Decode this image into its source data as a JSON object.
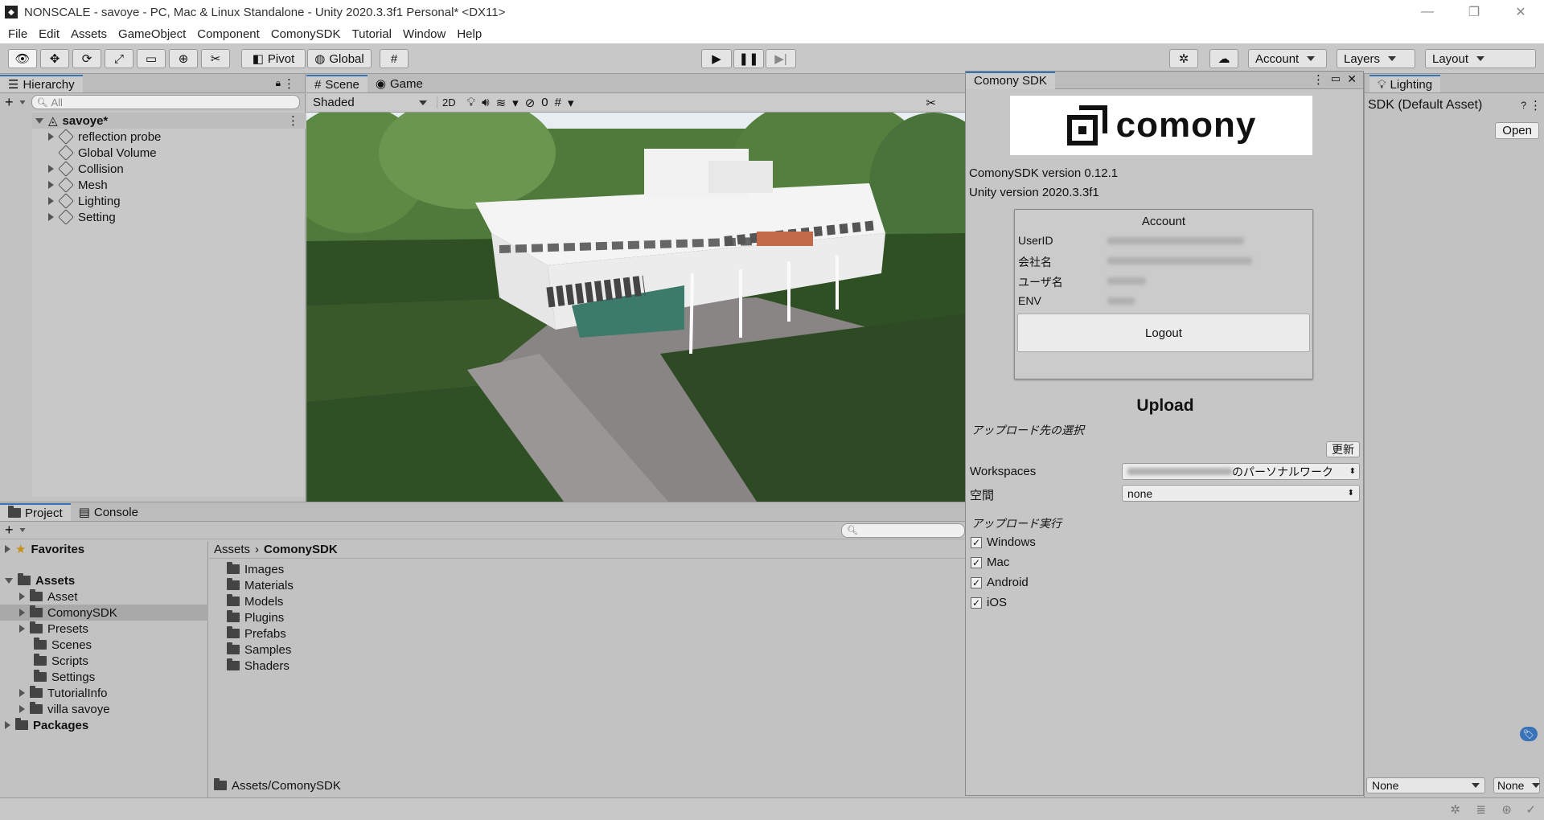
{
  "window": {
    "title": "NONSCALE - savoye - PC, Mac & Linux Standalone - Unity 2020.3.3f1 Personal* <DX11>"
  },
  "menu": [
    "File",
    "Edit",
    "Assets",
    "GameObject",
    "Component",
    "ComonySDK",
    "Tutorial",
    "Window",
    "Help"
  ],
  "toolbar": {
    "pivot": "Pivot",
    "global": "Global",
    "account": "Account",
    "layers": "Layers",
    "layout": "Layout"
  },
  "hierarchy": {
    "tab": "Hierarchy",
    "search_placeholder": "All",
    "scene": "savoye*",
    "items": [
      "reflection probe",
      "Global Volume",
      "Collision",
      "Mesh",
      "Lighting",
      "Setting"
    ]
  },
  "scene_view": {
    "tab_scene": "Scene",
    "tab_game": "Game",
    "shading": "Shaded",
    "mode_2d": "2D",
    "hidden_count": "0"
  },
  "project": {
    "tab_project": "Project",
    "tab_console": "Console",
    "favorites": "Favorites",
    "assets": "Assets",
    "tree": [
      "Asset",
      "ComonySDK",
      "Presets",
      "Scenes",
      "Scripts",
      "Settings",
      "TutorialInfo",
      "villa savoye"
    ],
    "packages": "Packages",
    "breadcrumb_root": "Assets",
    "breadcrumb_current": "ComonySDK",
    "folders": [
      "Images",
      "Materials",
      "Models",
      "Plugins",
      "Prefabs",
      "Samples",
      "Shaders"
    ],
    "footer_path": "Assets/ComonySDK"
  },
  "comony": {
    "tab": "Comony SDK",
    "logo_text": "comony",
    "sdk_version": "ComonySDK version 0.12.1",
    "unity_version": "Unity version 2020.3.3f1",
    "account_header": "Account",
    "fields": [
      "UserID",
      "会社名",
      "ユーザ名",
      "ENV"
    ],
    "logout": "Logout",
    "upload_title": "Upload",
    "upload_dest": "アップロード先の選択",
    "refresh": "更新",
    "workspaces_label": "Workspaces",
    "workspaces_value": "のパーソナルワーク",
    "space_label": "空間",
    "space_value": "none",
    "upload_exec": "アップロード実行",
    "platforms": [
      "Windows",
      "Mac",
      "Android",
      "iOS"
    ]
  },
  "inspector": {
    "tab": "Lighting",
    "asset": "SDK (Default Asset)",
    "open": "Open",
    "none1": "None",
    "none2": "None"
  }
}
